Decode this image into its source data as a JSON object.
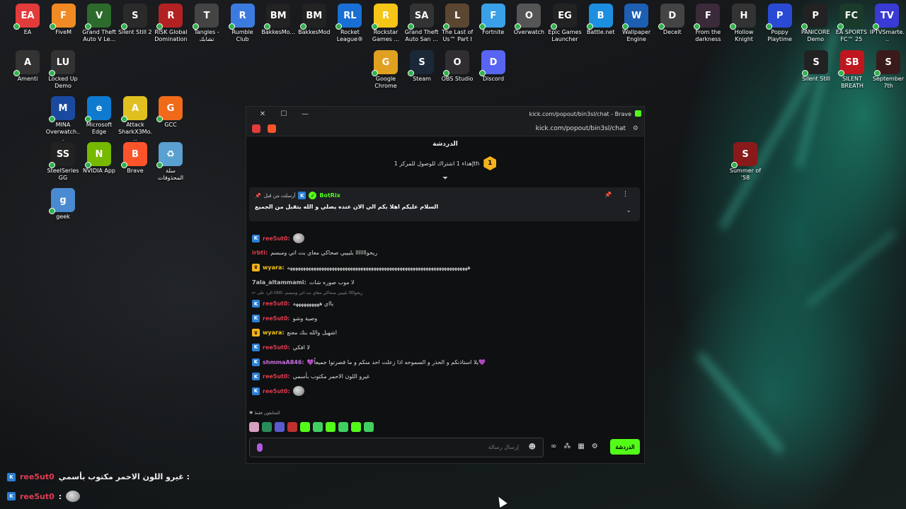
{
  "desktop_icons_row1": [
    {
      "label": "EA",
      "color": "#e23b3b",
      "glyph": "EA"
    },
    {
      "label": "FiveM",
      "color": "#f08a24",
      "glyph": "F"
    },
    {
      "label": "Grand Theft Auto V Le...",
      "color": "#2c6b2c",
      "glyph": "V"
    },
    {
      "label": "Silent Still 2",
      "color": "#2a2a2a",
      "glyph": "S"
    },
    {
      "label": "RISK Global Domination",
      "color": "#b32222",
      "glyph": "R"
    },
    {
      "label": "Tangles - تشابك",
      "color": "#444",
      "glyph": "T"
    },
    {
      "label": "Rumble Club",
      "color": "#3b7be0",
      "glyph": "R"
    },
    {
      "label": "BakkesMo...",
      "color": "#222",
      "glyph": "BM"
    },
    {
      "label": "BakkesMod",
      "color": "#222",
      "glyph": "BM"
    },
    {
      "label": "Rocket League®",
      "color": "#1a6fd4",
      "glyph": "RL"
    },
    {
      "label": "Rockstar Games ...",
      "color": "#f5c518",
      "glyph": "R"
    },
    {
      "label": "Grand Theft Auto San ...",
      "color": "#333",
      "glyph": "SA"
    },
    {
      "label": "The Last of Us™ Part I",
      "color": "#5a4631",
      "glyph": "L"
    },
    {
      "label": "Fortnite",
      "color": "#3aa0e8",
      "glyph": "F"
    },
    {
      "label": "Overwatch",
      "color": "#555",
      "glyph": "O"
    },
    {
      "label": "Epic Games Launcher",
      "color": "#222",
      "glyph": "EG"
    },
    {
      "label": "Battle.net",
      "color": "#1d8fe0",
      "glyph": "B"
    },
    {
      "label": "Wallpaper Engine",
      "color": "#1d5fb3",
      "glyph": "W"
    },
    {
      "label": "Deceit",
      "color": "#444",
      "glyph": "D"
    },
    {
      "label": "From the darkness",
      "color": "#3a2a3a",
      "glyph": "F"
    },
    {
      "label": "Hollow Knight",
      "color": "#333",
      "glyph": "H"
    },
    {
      "label": "Poppy Playtime",
      "color": "#2a4ad4",
      "glyph": "P"
    },
    {
      "label": "PANICORE Demo",
      "color": "#222",
      "glyph": "P"
    },
    {
      "label": "EA SPORTS FC™ 25",
      "color": "#1a3a2a",
      "glyph": "FC"
    },
    {
      "label": "IPTVSmarte...",
      "color": "#3a3ad4",
      "glyph": "TV"
    }
  ],
  "desktop_icons_row2": [
    {
      "label": "Amenti",
      "color": "#333",
      "glyph": "A"
    },
    {
      "label": "Locked Up Demo",
      "color": "#333",
      "glyph": "LU"
    },
    {
      "label": "Google Chrome",
      "color": "#e0a020",
      "glyph": "G"
    },
    {
      "label": "Steam",
      "color": "#1b2838",
      "glyph": "S"
    },
    {
      "label": "OBS Studio",
      "color": "#302e31",
      "glyph": "O"
    },
    {
      "label": "Discord",
      "color": "#5865f2",
      "glyph": "D"
    },
    {
      "label": "Silent Still",
      "color": "#222",
      "glyph": "S"
    },
    {
      "label": "SILENT BREATH",
      "color": "#c0161e",
      "glyph": "SB"
    },
    {
      "label": "September 7th",
      "color": "#3a1a1a",
      "glyph": "S"
    }
  ],
  "desktop_icons_col": [
    {
      "label": "MINA Overwatch...",
      "color": "#1a4aa0",
      "glyph": "M"
    },
    {
      "label": "Microsoft Edge",
      "color": "#0f7bd0",
      "glyph": "e"
    },
    {
      "label": "Attack SharkX3Mo...",
      "color": "#e0c020",
      "glyph": "A"
    },
    {
      "label": "GCC",
      "color": "#f06a1a",
      "glyph": "G"
    },
    {
      "label": "SteelSeries GG",
      "color": "#222",
      "glyph": "SS"
    },
    {
      "label": "NVIDIA App",
      "color": "#76b900",
      "glyph": "N"
    },
    {
      "label": "Brave",
      "color": "#fb542b",
      "glyph": "B"
    },
    {
      "label": "سلة المحذوفات",
      "color": "#5aa0d0",
      "glyph": "♻"
    },
    {
      "label": "geek",
      "color": "#4a8ad0",
      "glyph": "g"
    },
    {
      "label": "Summer of '58",
      "color": "#8a1a1a",
      "glyph": "S"
    }
  ],
  "window": {
    "title": "kick.com/popout/bin3sl/chat - Brave",
    "url": "kick.com/popout/bin3sl/chat",
    "header": "الدردشة",
    "goal_number": "1",
    "goal_text": "إهداء 1 اشتراك للوصول للمركز 1th"
  },
  "pinned": {
    "pinned_by": "أرسلت من قبل",
    "bot_name": "BotRix",
    "message": "السلام عليكم اهلا بكم الي الان عنده يصلي و الله يتقبل من الجميع"
  },
  "messages": [
    {
      "user": "ree5ut0",
      "ucls": "u-red",
      "badge": "k",
      "text": "",
      "avatar": true
    },
    {
      "user": "irbti",
      "ucls": "u-red",
      "badge": "",
      "text": "ريحوااااااا بليييي صحاكي معاي بت اتي ومبسم"
    },
    {
      "user": "wyara",
      "ucls": "u-yel",
      "badge": "c",
      "text": "هههههههههههههههههههههههههههههههههههههههههههههههههههههههههههههههههههههه"
    },
    {
      "user": "7ala_altammami",
      "ucls": "u-grey",
      "badge": "",
      "text": "لا موب صوره شات"
    },
    {
      "user": "ree5ut0",
      "ucls": "u-red",
      "badge": "k",
      "text": "يااي ههههههههههه",
      "reply": "الرد على irbti: ريحوااااا بليييي صحاكي معاي بت اتي ومبسم"
    },
    {
      "user": "ree5ut0",
      "ucls": "u-red",
      "badge": "k",
      "text": "وصية وشو"
    },
    {
      "user": "wyara",
      "ucls": "u-yel",
      "badge": "c",
      "text": "اشهيل والله بنك معنع"
    },
    {
      "user": "ree5ut0",
      "ucls": "u-red",
      "badge": "k",
      "text": "لا افكي"
    },
    {
      "user": "shmmaA846",
      "ucls": "u-mag",
      "badge": "k",
      "text": "💜يلا استاذنكم و الحذر و السموحه اذا زعلت احد منكم و ما قصرتوا جميعاً💜"
    },
    {
      "user": "ree5ut0",
      "ucls": "u-red",
      "badge": "k",
      "text": "غيرو اللون الاحمر مكتوب بأسمي"
    },
    {
      "user": "ree5ut0",
      "ucls": "u-red",
      "badge": "k",
      "text": "",
      "avatar": true
    }
  ],
  "subs_only": "المتابعون فقط",
  "input_placeholder": "إرسال رسالة",
  "send_label": "الدردشة",
  "overlay": [
    {
      "user": "ree5ut0",
      "text": "غيرو اللون الاحمر مكتوب بأسمي :",
      "avatar": false
    },
    {
      "user": "ree5ut0",
      "text": ":",
      "avatar": true
    }
  ]
}
